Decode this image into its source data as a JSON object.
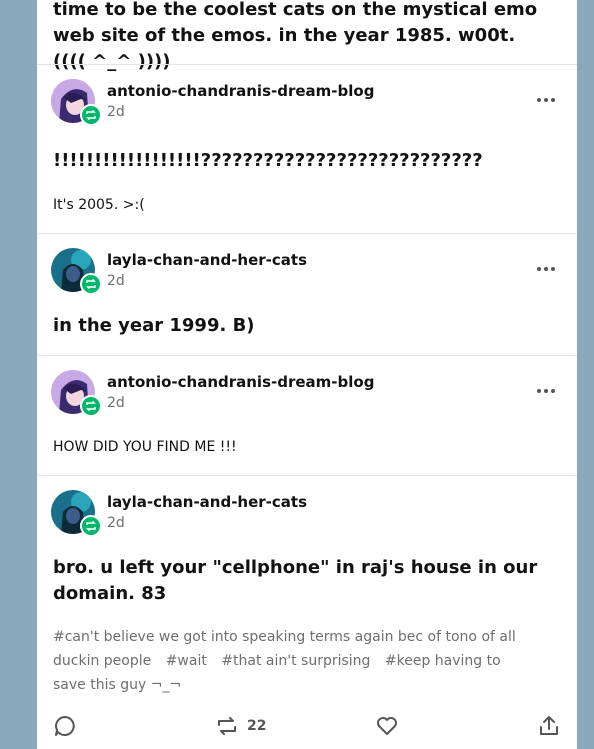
{
  "top_post_text": "time to be the coolest cats on the mystical emo web site of the emos. in the year 1985. w00t. (((( ^_^ ))))",
  "entries": [
    {
      "username": "antonio-chandranis-dream-blog",
      "time": "2d",
      "title": "!!!!!!!!!!!!!!!!!!???????????????????????????",
      "text": "It's 2005. >:("
    },
    {
      "username": "layla-chan-and-her-cats",
      "time": "2d",
      "title": "in the year 1999. B)"
    },
    {
      "username": "antonio-chandranis-dream-blog",
      "time": "2d",
      "text": "HOW DID YOU FIND ME !!!"
    },
    {
      "username": "layla-chan-and-her-cats",
      "time": "2d",
      "title": "bro. u left your \"cellphone\" in raj's house in our domain. 83"
    }
  ],
  "tags": [
    "#can't believe we got into speaking terms again bec of tono of all duckin people",
    "#wait",
    "#that ain't surprising",
    "#keep having to save this guy ¬_¬"
  ],
  "actions": {
    "reblog_count": "22"
  },
  "colors": {
    "background": "#8aa9bd",
    "card": "#ffffff",
    "reblog_badge": "#00b86b"
  }
}
